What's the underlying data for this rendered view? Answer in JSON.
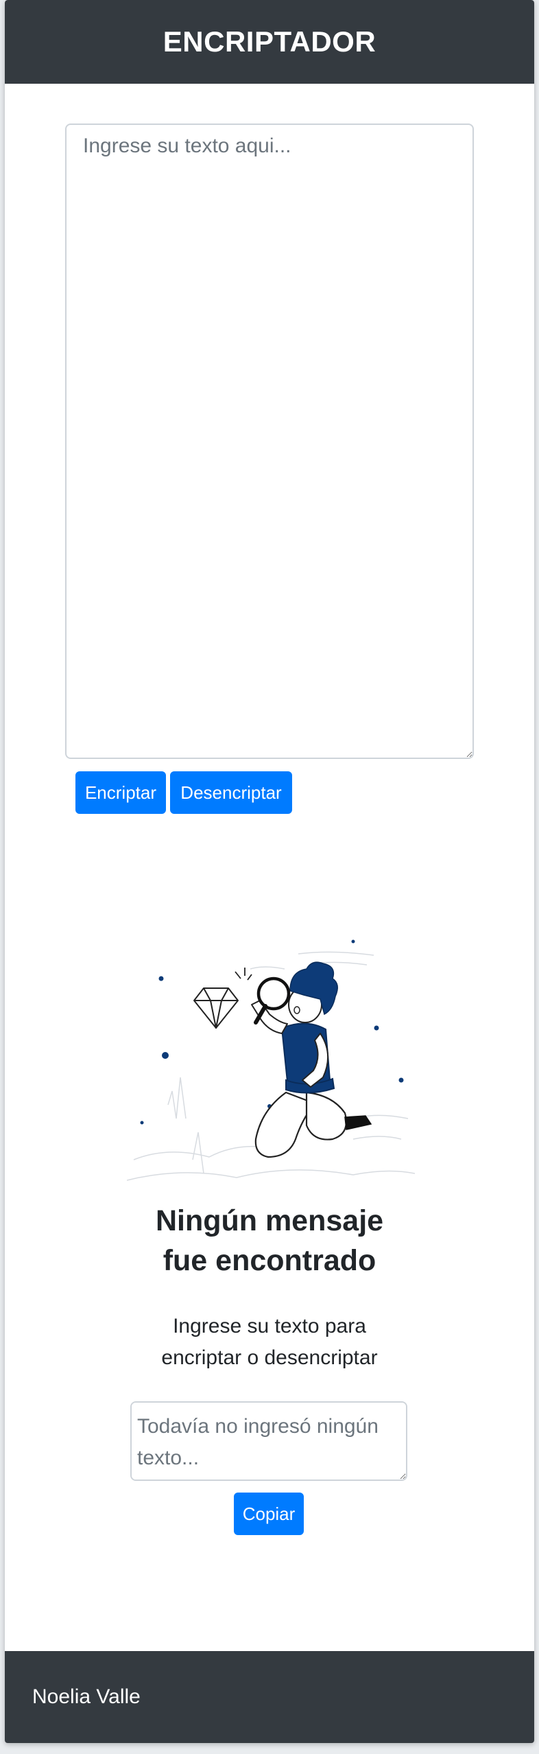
{
  "header": {
    "title": "ENCRIPTADOR"
  },
  "input": {
    "placeholder": "Ingrese su texto aqui..."
  },
  "actions": {
    "encrypt_label": "Encriptar",
    "decrypt_label": "Desencriptar"
  },
  "result": {
    "title_line1": "Ningún mensaje",
    "title_line2": "fue encontrado",
    "subtitle_line1": "Ingrese su texto para",
    "subtitle_line2": "encriptar o desencriptar",
    "output_placeholder": "Todavía no ingresó ningún texto...",
    "copy_label": "Copiar"
  },
  "footer": {
    "author": "Noelia Valle"
  },
  "colors": {
    "header_bg": "#343a40",
    "button_bg": "#007bff",
    "illustration_accent": "#0d3b78"
  },
  "icons": {
    "illustration": "person-magnifier-diamond-illustration"
  }
}
